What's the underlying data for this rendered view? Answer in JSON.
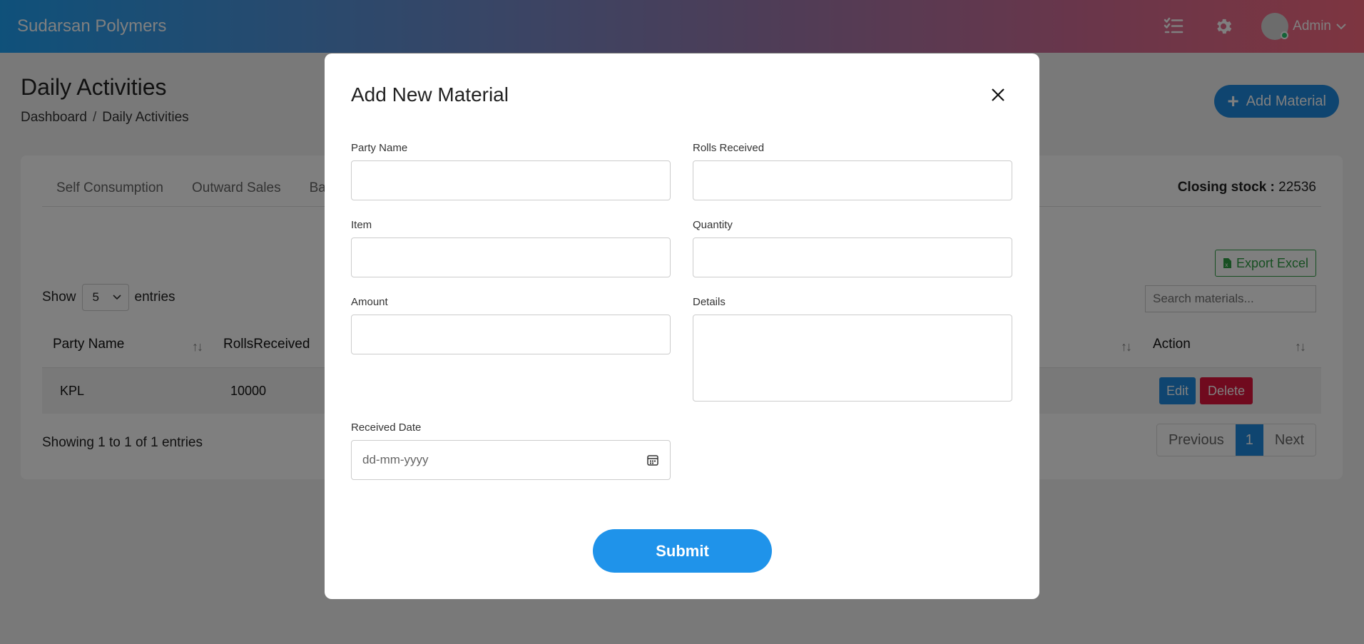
{
  "header": {
    "brand": "Sudarsan Polymers",
    "user_name": "Admin",
    "icons": [
      "tasks-icon",
      "gear-icon",
      "chevron-down-icon"
    ]
  },
  "page": {
    "title": "Daily Activities",
    "breadcrumb": [
      "Dashboard",
      "/",
      "Daily Activities"
    ],
    "add_button": "Add Material",
    "tabs": [
      "Self Consumption",
      "Outward Sales",
      "Ba"
    ],
    "closing_label": "Closing stock :",
    "closing_value": "22536",
    "export_button": "Export Excel",
    "show_label": "Show",
    "entries_label": "entries",
    "page_size": "5",
    "search_placeholder": "Search materials...",
    "columns": [
      "Party Name",
      "RollsReceived",
      "Action"
    ],
    "rows": [
      {
        "party_name": "KPL",
        "rolls_received": "10000",
        "edit": "Edit",
        "delete": "Delete"
      }
    ],
    "showing_text": "Showing 1 to 1 of 1 entries",
    "pagination": {
      "previous": "Previous",
      "current": "1",
      "next": "Next"
    }
  },
  "modal": {
    "title": "Add New Material",
    "fields": {
      "party_name": {
        "label": "Party Name",
        "value": ""
      },
      "rolls_received": {
        "label": "Rolls Received",
        "value": ""
      },
      "item": {
        "label": "Item",
        "value": ""
      },
      "quantity": {
        "label": "Quantity",
        "value": ""
      },
      "amount": {
        "label": "Amount",
        "value": ""
      },
      "details": {
        "label": "Details",
        "value": ""
      },
      "received_date": {
        "label": "Received Date",
        "placeholder": "dd-mm-yyyy"
      }
    },
    "submit_label": "Submit"
  },
  "colors": {
    "primary": "#1f8be0",
    "danger": "#e0143c",
    "success": "#2e9e44",
    "header_gradient_start": "#1fa2f5",
    "header_gradient_end": "#fb6b81"
  }
}
